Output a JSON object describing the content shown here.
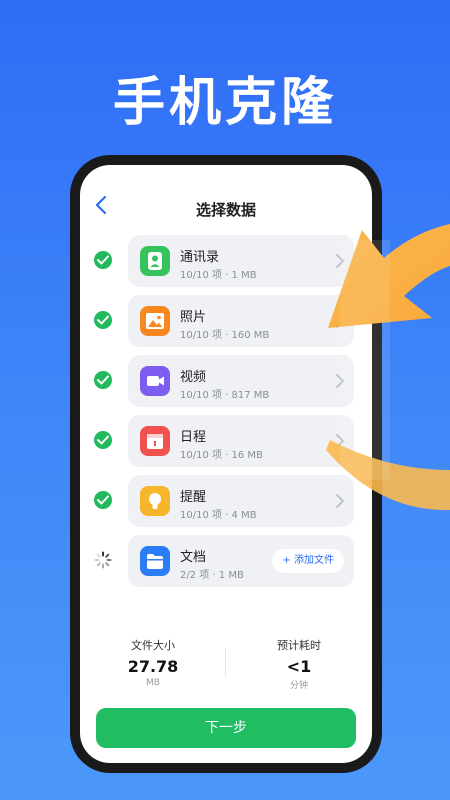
{
  "headline": "手机克隆",
  "nav": {
    "title": "选择数据"
  },
  "items": [
    {
      "label": "通讯录",
      "meta": "10/10 项 · 1 MB",
      "status": "done",
      "icon": "contacts-icon",
      "color": "#34c35c"
    },
    {
      "label": "照片",
      "meta": "10/10 项 · 160 MB",
      "status": "done",
      "icon": "photos-icon",
      "color": "#f7871f"
    },
    {
      "label": "视频",
      "meta": "10/10 项 · 817 MB",
      "status": "done",
      "icon": "video-icon",
      "color": "#7d5cf0"
    },
    {
      "label": "日程",
      "meta": "10/10 项 · 16 MB",
      "status": "done",
      "icon": "calendar-icon",
      "color": "#f2524f"
    },
    {
      "label": "提醒",
      "meta": "10/10 项 · 4 MB",
      "status": "done",
      "icon": "lightbulb-icon",
      "color": "#f7b52b"
    },
    {
      "label": "文档",
      "meta": "2/2 项 · 1 MB",
      "status": "loading",
      "icon": "folder-icon",
      "color": "#2a7df5",
      "action": "+ 添加文件"
    }
  ],
  "stats": {
    "size": {
      "label": "文件大小",
      "value": "27.78",
      "unit": "MB"
    },
    "time": {
      "label": "预计耗时",
      "value": "<1",
      "unit": "分钟"
    }
  },
  "next_label": "下一步",
  "colors": {
    "accent": "#2a6df5",
    "success": "#22b85c",
    "arrow": "#fbb34a"
  }
}
